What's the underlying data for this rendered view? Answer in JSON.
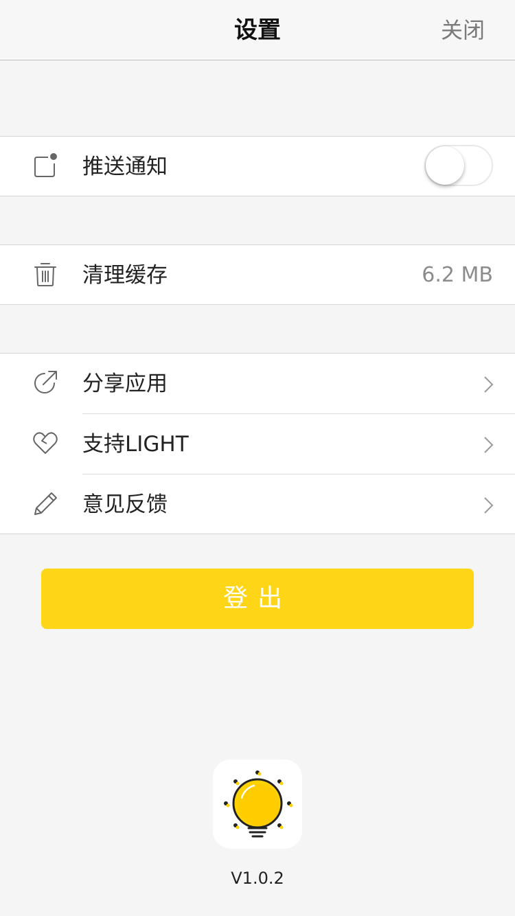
{
  "header": {
    "title": "设置",
    "close_label": "关闭"
  },
  "settings": {
    "push": {
      "label": "推送通知",
      "icon": "notification-icon",
      "enabled": false
    },
    "cache": {
      "label": "清理缓存",
      "icon": "trash-icon",
      "value": "6.2 MB"
    },
    "menu": [
      {
        "label": "分享应用",
        "icon": "share-icon"
      },
      {
        "label": "支持LIGHT",
        "icon": "heart-icon"
      },
      {
        "label": "意见反馈",
        "icon": "pencil-icon"
      }
    ]
  },
  "logout_label": "登出",
  "app": {
    "logo_icon": "lightbulb-icon",
    "version": "V1.0.2"
  },
  "colors": {
    "accent": "#ffd617",
    "background": "#f5f5f5"
  }
}
